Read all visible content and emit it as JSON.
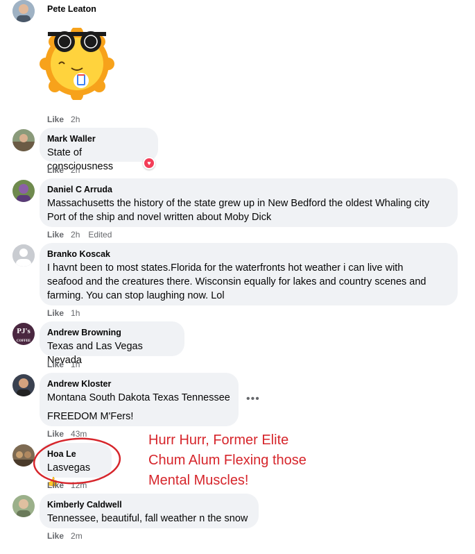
{
  "comments": [
    {
      "author": "Pete Leaton",
      "like": "Like",
      "time": "2h",
      "sticker": "sun-with-sunglasses-sticker"
    },
    {
      "author": "Mark Waller",
      "text": [
        "State of consciousness"
      ],
      "like": "Like",
      "time": "2h",
      "reaction": "love-icon"
    },
    {
      "author": "Daniel C Arruda",
      "text": [
        "Massachusetts the history of the state grew up in New Bedford the oldest Whaling city",
        "Port of the ship and novel written about Moby Dick"
      ],
      "like": "Like",
      "time": "2h",
      "edited": "Edited"
    },
    {
      "author": "Branko Koscak",
      "text": [
        "I havnt been to most states.Florida for the waterfronts hot weather i can live with",
        "seafood and the creatures there. Wisconsin equally for lakes and country scenes and",
        "farming. You can stop laughing now. Lol"
      ],
      "like": "Like",
      "time": "1h"
    },
    {
      "author": "Andrew Browning",
      "text": [
        "Texas and Las Vegas Nevada"
      ],
      "like": "Like",
      "time": "1h",
      "avatar_text": "PJ's",
      "avatar_subtext": "COFFEE"
    },
    {
      "author": "Andrew Kloster",
      "text": [
        "Montana South Dakota Texas Tennessee"
      ],
      "text2": "FREEDOM M'Fers!",
      "like": "Like",
      "time": "43m"
    },
    {
      "author": "Hoa Le",
      "text": [
        "Lasvegas"
      ],
      "emoji": "👍",
      "like": "Like",
      "time": "12m"
    },
    {
      "author": "Kimberly Caldwell",
      "text": [
        "Tennessee, beautiful, fall weather n the snow"
      ],
      "like": "Like",
      "time": "2m"
    }
  ],
  "more_options_glyph": "•••",
  "annotation": [
    "Hurr Hurr, Former Elite",
    "Chum Alum Flexing those",
    "Mental Muscles!"
  ],
  "colors": {
    "bubble": "#f0f2f5",
    "meta": "#65676b",
    "annotation": "#d6252b",
    "love": "#f33e58"
  }
}
